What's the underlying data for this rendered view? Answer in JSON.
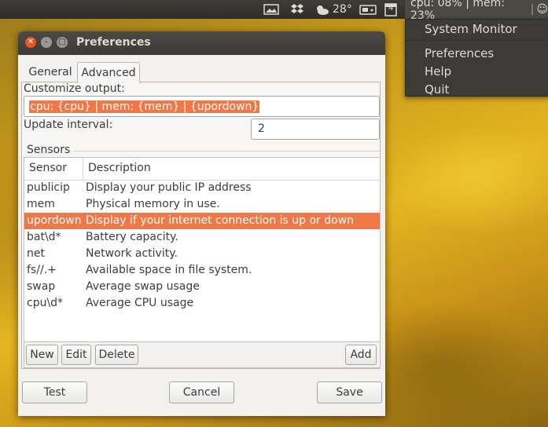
{
  "panel": {
    "weather_temp": "28°",
    "calendar_day": "4",
    "sysmon_text": "cpu: 08% | mem: 23%"
  },
  "menu": {
    "items": [
      "System Monitor",
      "Preferences",
      "Help",
      "Quit"
    ]
  },
  "window": {
    "title": "Preferences",
    "tabs": [
      "General",
      "Advanced"
    ],
    "customize_label": "Customize output:",
    "customize_value": "cpu: {cpu} | mem: {mem} | {upordown}",
    "interval_label": "Update interval:",
    "interval_value": "2",
    "sensors_label": "Sensors",
    "columns": [
      "Sensor",
      "Description"
    ],
    "rows": [
      {
        "sensor": "publicip",
        "description": "Display your public IP address"
      },
      {
        "sensor": "mem",
        "description": "Physical memory in use."
      },
      {
        "sensor": "upordown",
        "description": "Display if your internet connection is up or down"
      },
      {
        "sensor": "bat\\d*",
        "description": "Battery capacity."
      },
      {
        "sensor": "net",
        "description": "Network activity."
      },
      {
        "sensor": "fs//.+",
        "description": "Available space in file system."
      },
      {
        "sensor": "swap",
        "description": "Average swap usage"
      },
      {
        "sensor": "cpu\\d*",
        "description": "Average CPU usage"
      }
    ],
    "list_buttons": {
      "new": "New",
      "edit": "Edit",
      "delete": "Delete",
      "add": "Add"
    },
    "footer_buttons": {
      "test": "Test",
      "cancel": "Cancel",
      "save": "Save"
    }
  },
  "colors": {
    "accent": "#f07746",
    "panel": "#3c3b37",
    "close_button": "#e95420"
  }
}
